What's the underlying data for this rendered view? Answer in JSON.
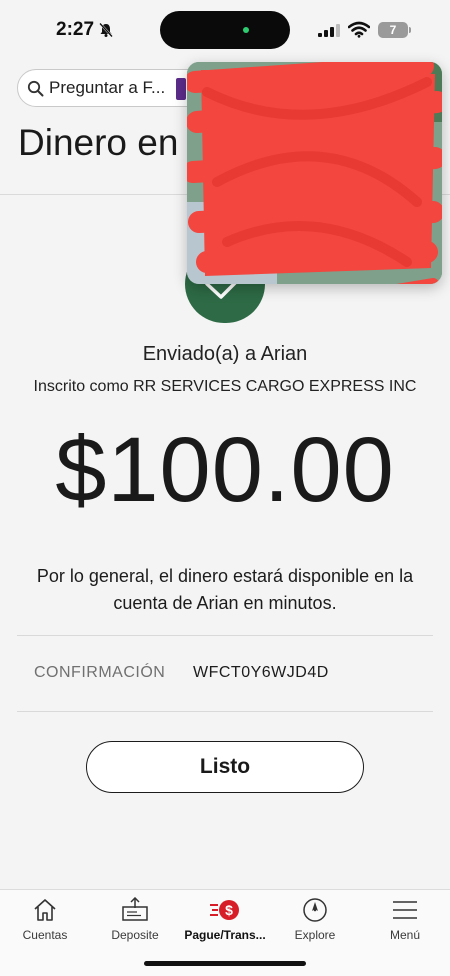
{
  "status_bar": {
    "time": "2:27",
    "battery": "7"
  },
  "search": {
    "text": "Preguntar a F..."
  },
  "page": {
    "title": "Dinero en"
  },
  "confirmation_screen": {
    "sent_to": "Enviado(a) a Arian",
    "enrolled_as": "Inscrito como RR SERVICES CARGO EXPRESS INC",
    "amount": "$100.00",
    "availability_note": "Por lo general, el dinero estará disponible en la cuenta de Arian en minutos.",
    "confirmation_label": "CONFIRMACIÓN",
    "confirmation_value": "WFCT0Y6WJD4D",
    "done_label": "Listo"
  },
  "tab_bar": {
    "items": [
      {
        "label": "Cuentas",
        "icon": "home-icon"
      },
      {
        "label": "Deposite",
        "icon": "check-deposit-icon"
      },
      {
        "label": "Pague/Trans...",
        "icon": "pay-transfer-icon"
      },
      {
        "label": "Explore",
        "icon": "compass-icon"
      },
      {
        "label": "Menú",
        "icon": "hamburger-menu-icon"
      }
    ],
    "active": "Pague/Trans..."
  },
  "colors": {
    "success_green": "#2d6a45",
    "accent_red": "#d71e28",
    "redaction_red": "#f2463e"
  }
}
